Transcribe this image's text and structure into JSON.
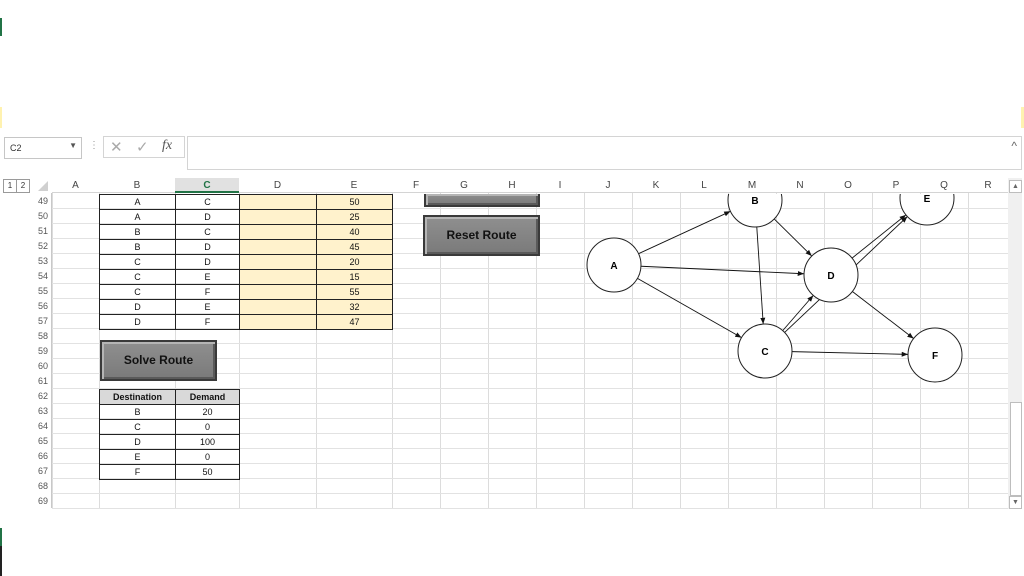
{
  "formula_bar": {
    "name_box": "C2",
    "cancel_icon": "✕",
    "enter_icon": "✓",
    "fx_label": "fx",
    "formula": ""
  },
  "outline_levels": [
    "1",
    "2"
  ],
  "columns": [
    "A",
    "B",
    "C",
    "D",
    "E",
    "F",
    "G",
    "H",
    "I",
    "J",
    "K",
    "L",
    "M",
    "N",
    "O",
    "P",
    "Q",
    "R"
  ],
  "selected_column": "C",
  "rows": [
    "49",
    "50",
    "51",
    "52",
    "53",
    "54",
    "55",
    "56",
    "57",
    "58",
    "59",
    "60",
    "61",
    "62",
    "63",
    "64",
    "65",
    "66",
    "67",
    "68",
    "69"
  ],
  "arcs_table": {
    "rows": [
      {
        "from": "A",
        "to": "C",
        "flow": "",
        "cost": "50"
      },
      {
        "from": "A",
        "to": "D",
        "flow": "",
        "cost": "25"
      },
      {
        "from": "B",
        "to": "C",
        "flow": "",
        "cost": "40"
      },
      {
        "from": "B",
        "to": "D",
        "flow": "",
        "cost": "45"
      },
      {
        "from": "C",
        "to": "D",
        "flow": "",
        "cost": "20"
      },
      {
        "from": "C",
        "to": "E",
        "flow": "",
        "cost": "15"
      },
      {
        "from": "C",
        "to": "F",
        "flow": "",
        "cost": "55"
      },
      {
        "from": "D",
        "to": "E",
        "flow": "",
        "cost": "32"
      },
      {
        "from": "D",
        "to": "F",
        "flow": "",
        "cost": "47"
      }
    ]
  },
  "buttons": {
    "solve": "Solve Route",
    "reset": "Reset Route"
  },
  "demand_table": {
    "headers": [
      "Destination",
      "Demand"
    ],
    "rows": [
      {
        "dest": "B",
        "demand": "20"
      },
      {
        "dest": "C",
        "demand": "0"
      },
      {
        "dest": "D",
        "demand": "100"
      },
      {
        "dest": "E",
        "demand": "0"
      },
      {
        "dest": "F",
        "demand": "50"
      }
    ]
  },
  "network": {
    "nodes": [
      "A",
      "B",
      "C",
      "D",
      "E",
      "F"
    ],
    "edges": [
      [
        "A",
        "B"
      ],
      [
        "A",
        "D"
      ],
      [
        "A",
        "C"
      ],
      [
        "B",
        "C"
      ],
      [
        "B",
        "D"
      ],
      [
        "C",
        "D"
      ],
      [
        "C",
        "E"
      ],
      [
        "C",
        "F"
      ],
      [
        "D",
        "E"
      ],
      [
        "D",
        "F"
      ]
    ]
  },
  "scrollbar": {
    "up_icon": "▲",
    "down_icon": "▼"
  }
}
